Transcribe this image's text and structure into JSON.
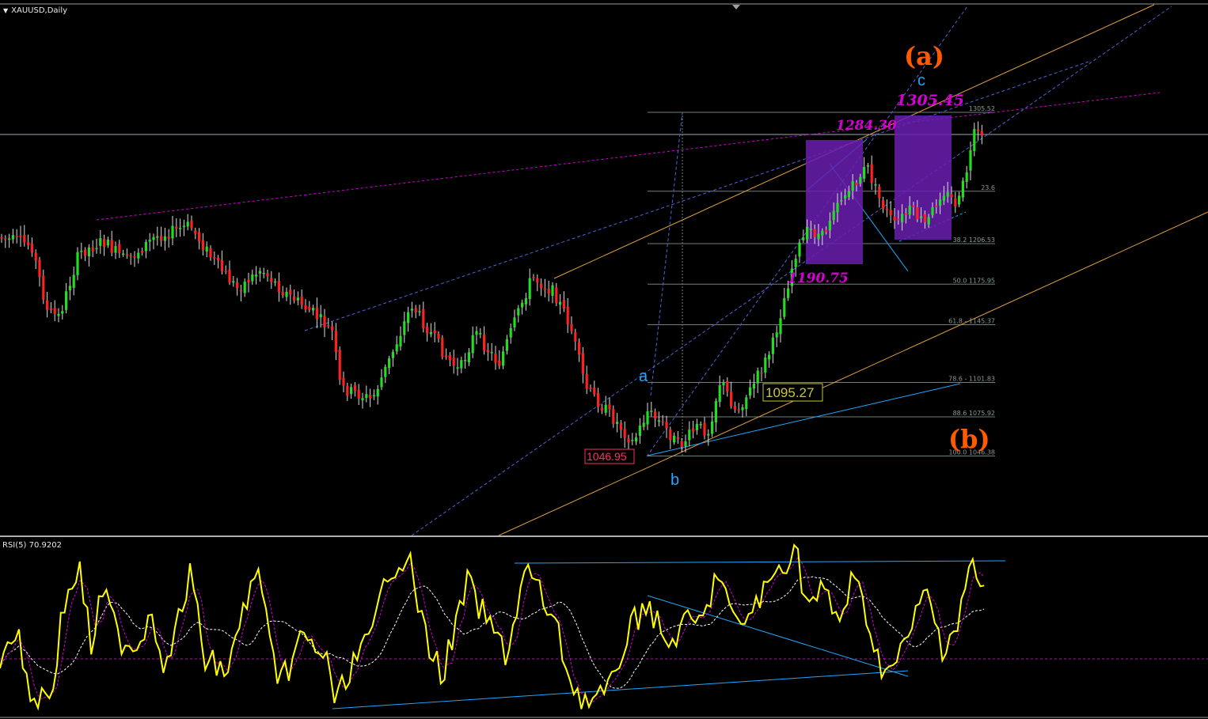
{
  "window": {
    "symbol_label": "XAUUSD,Daily",
    "rsi_label": "RSI(5) 70.9202"
  },
  "chart_data": [
    {
      "type": "candlestick",
      "title": "XAUUSD,Daily",
      "annotations": {
        "wave_labels": [
          {
            "text": "(a)",
            "color": "#ff5a00"
          },
          {
            "text": "c",
            "color": "#1fa8ff"
          },
          {
            "text": "a",
            "color": "#1fa8ff"
          },
          {
            "text": "b",
            "color": "#1fa8ff"
          },
          {
            "text": "(b)",
            "color": "#ff5a00"
          }
        ],
        "price_marks": [
          {
            "text": "1305.45",
            "color": "#d400d4"
          },
          {
            "text": "1284.30",
            "color": "#d400d4"
          },
          {
            "text": "1190.75",
            "color": "#d400d4"
          }
        ],
        "boxed_prices": [
          {
            "text": "1095.27",
            "color": "#c8c832"
          },
          {
            "text": "1046.95",
            "color": "#ff2d6d"
          }
        ]
      },
      "fib_levels": [
        {
          "label": "1305.52",
          "value": 1305.52
        },
        {
          "label": "23.6",
          "value": 1246.0
        },
        {
          "label": "38.2 1206.53",
          "value": 1206.53
        },
        {
          "label": "50.0 1175.95",
          "value": 1175.95
        },
        {
          "label": "61.8 - 1145.37",
          "value": 1145.37
        },
        {
          "label": "78.6 - 1101.83",
          "value": 1101.83
        },
        {
          "label": "88.6 1075.92",
          "value": 1075.92
        },
        {
          "label": "100.0 1046.38",
          "value": 1046.38
        }
      ],
      "colors": {
        "bull": "#22dd22",
        "bear": "#ff2020",
        "wick": "#dddddd",
        "fib": "#6e7f7a",
        "fib_text": "#8a9a94",
        "box": "#6a1fb0"
      }
    },
    {
      "type": "line",
      "title": "RSI(5) 70.9202",
      "series": [
        {
          "name": "RSI(5)",
          "color": "#ffff00"
        }
      ],
      "colors": {
        "signal": "#d400d4",
        "ma": "#ffffff",
        "trend": "#1fa8ff"
      }
    }
  ]
}
